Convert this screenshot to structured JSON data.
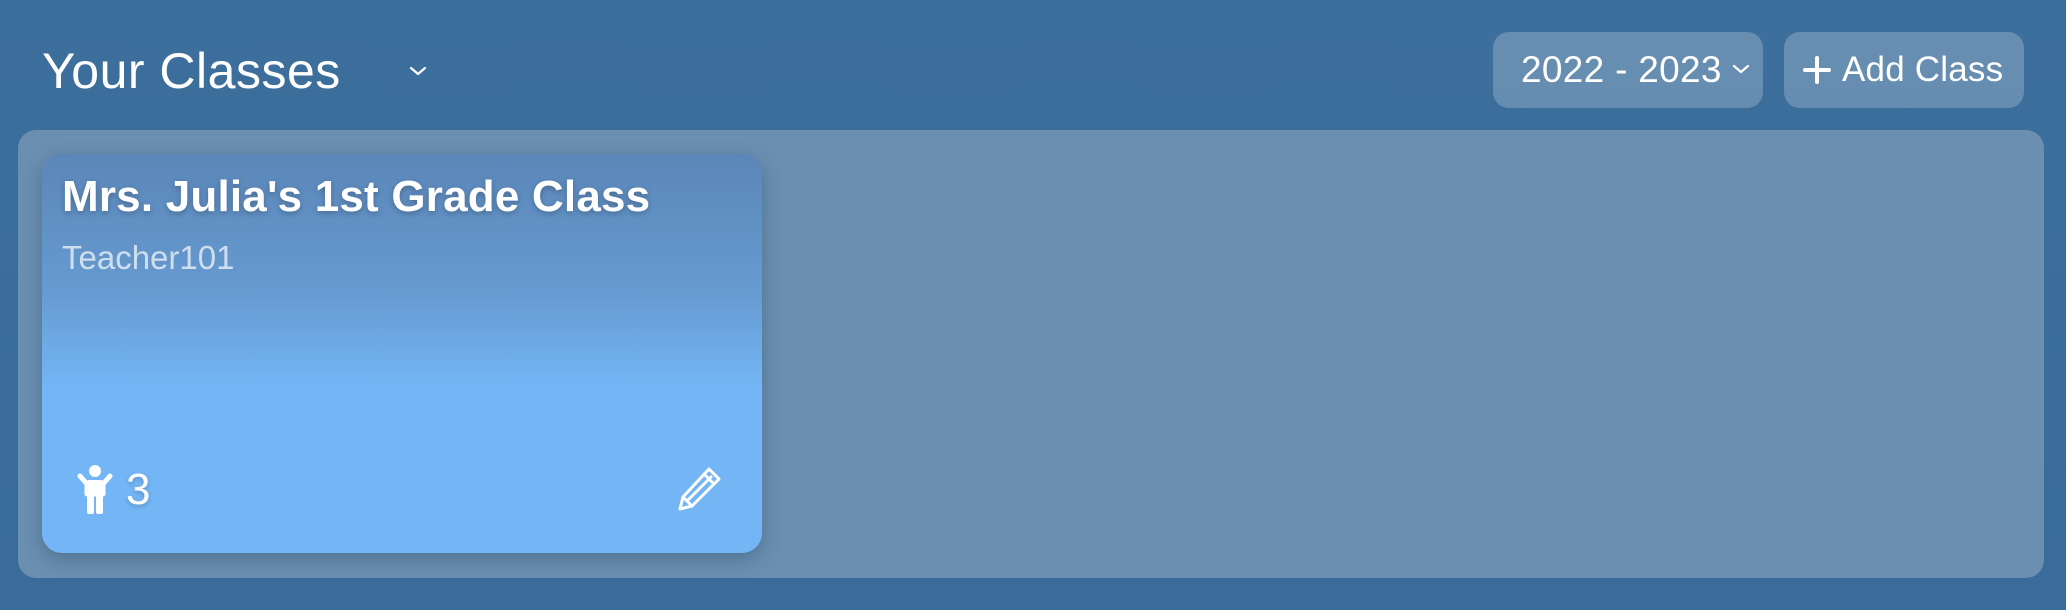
{
  "header": {
    "title": "Your Classes",
    "title_menu_icon": "chevron-down-icon",
    "year_select": {
      "selected": "2022 - 2023",
      "icon": "chevron-down-icon"
    },
    "add_class": {
      "icon": "plus-icon",
      "label": "Add Class"
    }
  },
  "classes": [
    {
      "name": "Mrs. Julia's 1st Grade Class",
      "teacher": "Teacher101",
      "student_icon": "child-icon",
      "student_count": "3",
      "edit_icon": "pencil-icon"
    }
  ],
  "colors": {
    "background": "#3c6e9b",
    "panel": "#6a8fb0",
    "card_top": "#5b86b8",
    "card_bottom": "#73b5f5",
    "button_bg": "rgba(255,255,255,0.22)",
    "text": "#ffffff"
  }
}
